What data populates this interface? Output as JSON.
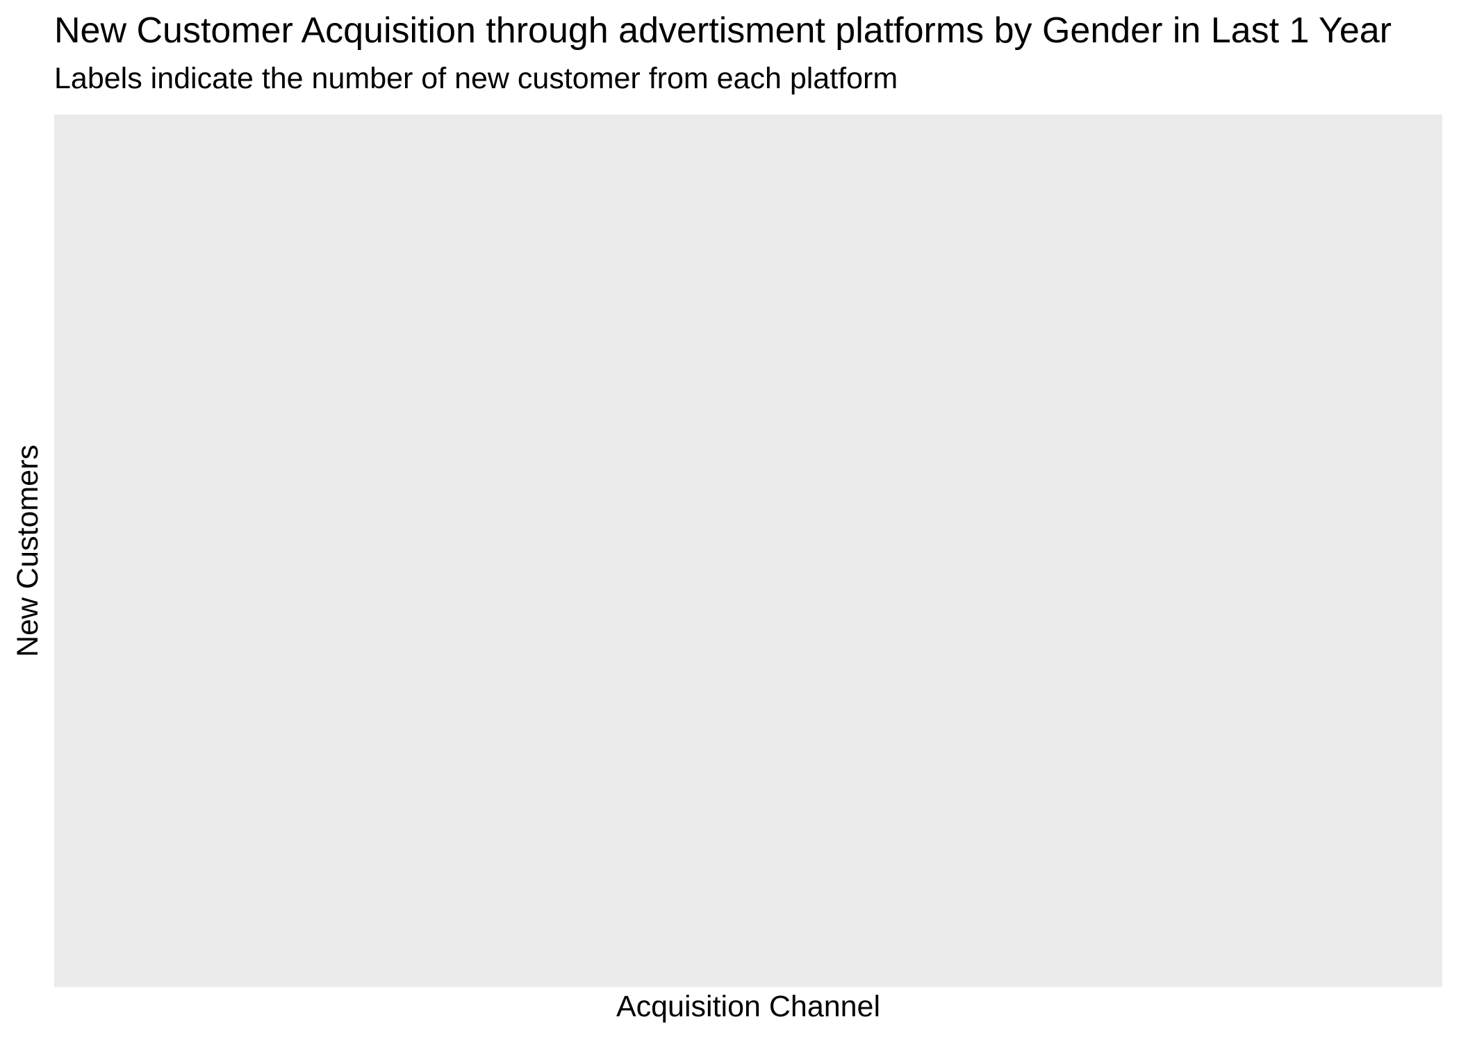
{
  "chart_data": {
    "type": "bar",
    "title": "New Customer Acquisition through advertisment platforms by Gender in Last 1 Year",
    "subtitle": "Labels indicate the number of new customer from each platform",
    "xlabel": "Acquisition Channel",
    "ylabel": "New Customers",
    "categories": [],
    "series": [],
    "grid": false,
    "legend": "none",
    "panel_background": "#EBEBEB"
  }
}
